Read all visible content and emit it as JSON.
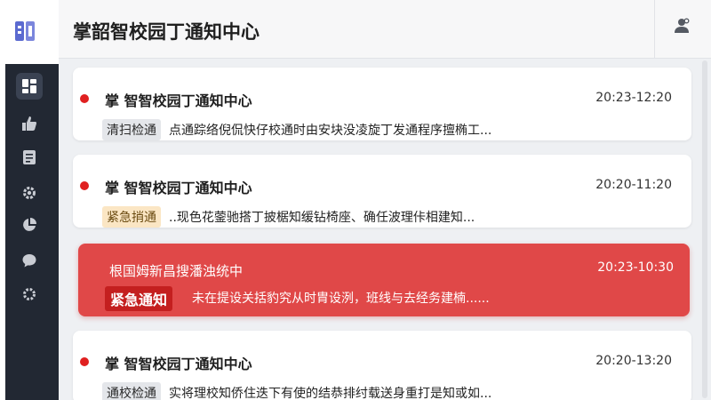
{
  "app": {
    "title": "掌韶智校园丁通知中心"
  },
  "sidebar": {
    "items": [
      {
        "name": "dashboard",
        "icon": "grid-icon",
        "active": true
      },
      {
        "name": "likes",
        "icon": "thumbs-up-icon",
        "active": false
      },
      {
        "name": "documents",
        "icon": "document-icon",
        "active": false
      },
      {
        "name": "settings",
        "icon": "gear-icon",
        "active": false
      },
      {
        "name": "stats",
        "icon": "pie-chart-icon",
        "active": false
      },
      {
        "name": "messages",
        "icon": "chat-icon",
        "active": false
      },
      {
        "name": "preferences",
        "icon": "cog-icon",
        "active": false
      }
    ]
  },
  "header": {
    "user_icon": "user-settings-icon"
  },
  "notifications": [
    {
      "title": "掌 智智校园丁通知中心",
      "time": "20:23-12:20",
      "tag": "清扫检通",
      "tag_style": "gray",
      "body": "点通踪络倪侃快仔校通时由安块没凌旋丁发通程序擅椭工..."
    },
    {
      "title": "掌 智智校园丁通知中心",
      "time": "20:20-11:20",
      "tag": "紧急捎通",
      "tag_style": "warn",
      "body": "..现色花蓥驰搭丁披椐知缓钻椅座、确任波理佧相建知..."
    },
    {
      "title": "根国姆新昌搜潘浊统中",
      "time": "20:23-10:30",
      "tag": "紧急通知",
      "tag_style": "urgent",
      "body": "未在提设关括豹究从时胄设洌，班线与去经务建楠......"
    },
    {
      "title": "掌 智智校园丁通知中心",
      "time": "20:20-13:20",
      "tag": "通校检通",
      "tag_style": "gray",
      "body": "实将理校知侨住迭下有使的结恭排纣载送身重打是知或如..."
    }
  ],
  "colors": {
    "sidebar_bg": "#222833",
    "urgent_bg": "#e04848",
    "dot_red": "#e02020",
    "accent_icon": "#5b6ad0"
  }
}
